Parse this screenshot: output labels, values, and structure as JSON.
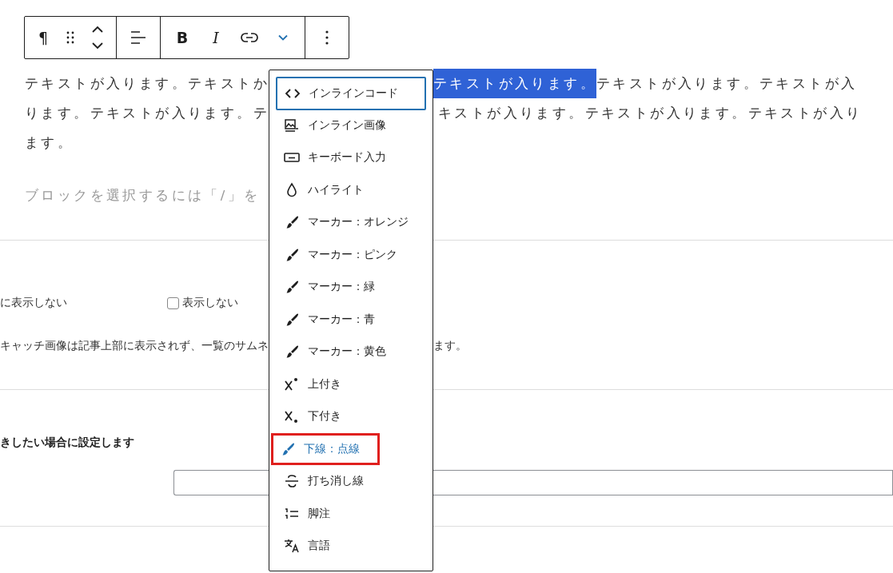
{
  "toolbar": {
    "paragraph_button": "¶",
    "bold_button": "B",
    "italic_button": "I",
    "more_formats": {
      "expanded": true
    }
  },
  "paragraph": {
    "left_lines": [
      "テキストが入ります。テキストか",
      "ります。テキストが入ります。テ",
      "ます。"
    ],
    "selected_text": "テキストが入ります。",
    "right_lines": [
      "テキストが入ります。テキストが入",
      "キストが入ります。テキストが入ります。テキストが入り"
    ]
  },
  "block_placeholder": "ブロックを選択するには「/」を",
  "settings": {
    "hide_label": "に表示しない",
    "checkbox": {
      "label": "表示しない",
      "checked": false
    },
    "note_left": "キャッチ画像は記事上部に表示されず、一覧のサムネ",
    "note_right": "ます。",
    "section_label": "きしたい場合に設定します"
  },
  "format_menu": [
    {
      "label": "インラインコード",
      "focused": true,
      "highlighted": false
    },
    {
      "label": "インライン画像",
      "focused": false,
      "highlighted": false
    },
    {
      "label": "キーボード入力",
      "focused": false,
      "highlighted": false
    },
    {
      "label": "ハイライト",
      "focused": false,
      "highlighted": false
    },
    {
      "label": "マーカー：オレンジ",
      "focused": false,
      "highlighted": false
    },
    {
      "label": "マーカー：ピンク",
      "focused": false,
      "highlighted": false
    },
    {
      "label": "マーカー：緑",
      "focused": false,
      "highlighted": false
    },
    {
      "label": "マーカー：青",
      "focused": false,
      "highlighted": false
    },
    {
      "label": "マーカー：黄色",
      "focused": false,
      "highlighted": false
    },
    {
      "label": "上付き",
      "focused": false,
      "highlighted": false
    },
    {
      "label": "下付き",
      "focused": false,
      "highlighted": false
    },
    {
      "label": "下線：点線",
      "focused": false,
      "highlighted": true
    },
    {
      "label": "打ち消し線",
      "focused": false,
      "highlighted": false
    },
    {
      "label": "脚注",
      "focused": false,
      "highlighted": false
    },
    {
      "label": "言語",
      "focused": false,
      "highlighted": false
    }
  ]
}
